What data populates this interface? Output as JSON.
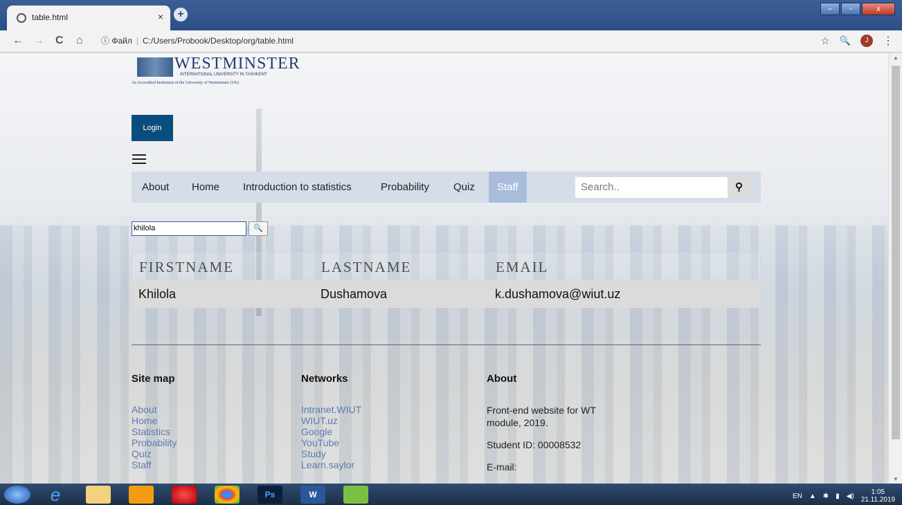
{
  "browser": {
    "tab_title": "table.html",
    "tab_close": "×",
    "new_tab": "+",
    "back": "←",
    "forward": "→",
    "reload": "C",
    "home": "⌂",
    "info": "ⓘ",
    "file_label": "Файл",
    "address": "C:/Users/Probook/Desktop/org/table.html",
    "star": "☆",
    "search": "🔍",
    "avatar_letter": "J",
    "menu": "⋮",
    "min": "–",
    "max": "▫",
    "close": "x"
  },
  "logo": {
    "name": "WESTMINSTER",
    "sub": "INTERNATIONAL UNIVERSITY IN TASHKENT",
    "tagline": "An Accredited Institution of the University of Westminster (UK)"
  },
  "login_label": "Login",
  "nav": {
    "items": [
      "About",
      "Home",
      "Introduction to statistics",
      "Probability",
      "Quiz"
    ],
    "active": "Staff",
    "search_placeholder": "Search.."
  },
  "filter": {
    "value": "khilola",
    "button": "🔍"
  },
  "table": {
    "headers": [
      "FIRSTNAME",
      "LASTNAME",
      "EMAIL"
    ],
    "rows": [
      [
        "Khilola",
        "Dushamova",
        "k.dushamova@wiut.uz"
      ]
    ]
  },
  "footer": {
    "sitemap": {
      "title": "Site map",
      "links": [
        "About",
        "Home",
        "Statistics",
        "Probability",
        "Quiz",
        "Staff"
      ]
    },
    "networks": {
      "title": "Networks",
      "links": [
        "Intranet.WIUT",
        "WIUT.uz",
        "Google",
        "YouTube",
        "Study",
        "Learn.saylor"
      ]
    },
    "about": {
      "title": "About",
      "line1": "Front-end website for WT module, 2019.",
      "line2": "Student ID: 00008532",
      "line3": "E-mail:"
    }
  },
  "taskbar": {
    "lang": "EN",
    "time": "1:05",
    "date": "21.11.2019"
  }
}
